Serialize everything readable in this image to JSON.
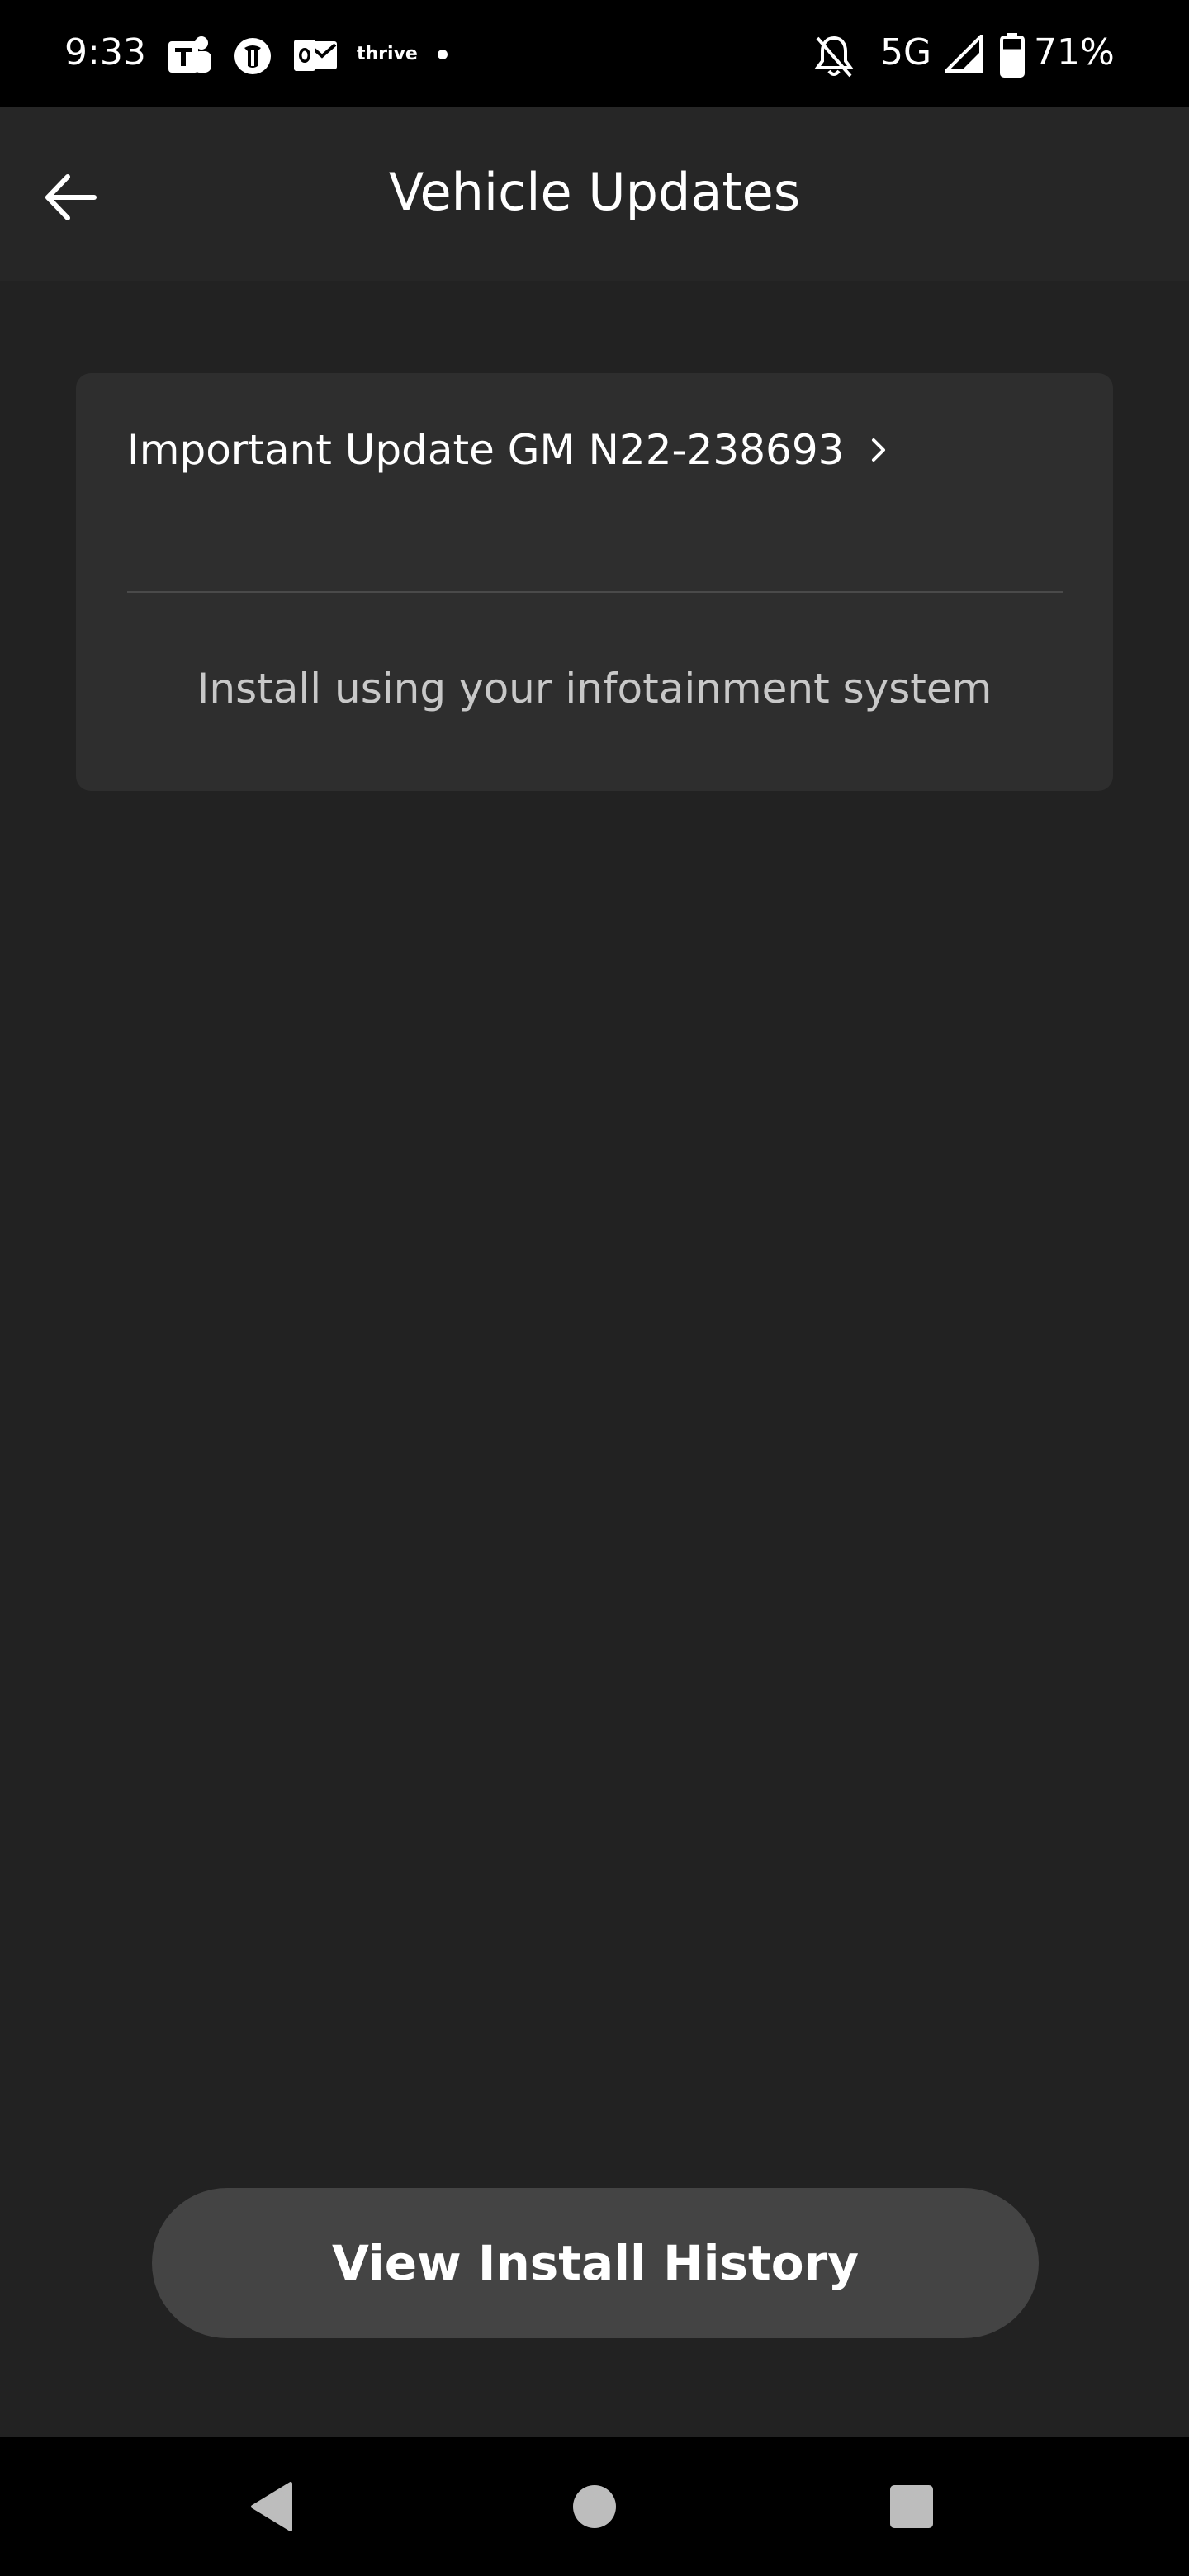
{
  "status_bar": {
    "time": "9:33",
    "notification_icons": [
      "teams-icon",
      "nytimes-icon",
      "outlook-icon",
      "thrive-icon",
      "more-notifications-dot-icon"
    ],
    "thrive_label": "thrive",
    "network": "5G",
    "battery": "71%",
    "battery_level": 0.71
  },
  "app_bar": {
    "title": "Vehicle Updates",
    "back_icon": "arrow-left-icon"
  },
  "update_card": {
    "title": "Important Update GM N22-238693",
    "chevron_icon": "chevron-right-icon",
    "hint": "Install using your infotainment system"
  },
  "history_button": {
    "label": "View Install History"
  },
  "nav_bar": {
    "back_icon": "nav-back-icon",
    "home_icon": "nav-home-icon",
    "recents_icon": "nav-recents-icon"
  },
  "colors": {
    "background": "#222222",
    "card": "#2e2e2e",
    "button": "#444444",
    "text_primary": "#ffffff",
    "text_secondary": "#c8c8c8"
  }
}
